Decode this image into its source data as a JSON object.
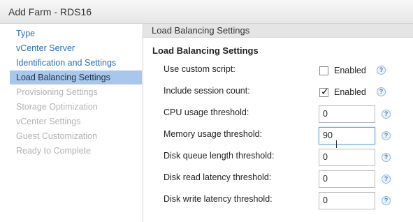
{
  "window": {
    "title": "Add Farm - RDS16"
  },
  "sidebar": {
    "items": [
      {
        "label": "Type",
        "state": "link"
      },
      {
        "label": "vCenter Server",
        "state": "link"
      },
      {
        "label": "Identification and Settings",
        "state": "link"
      },
      {
        "label": "Load Balancing Settings",
        "state": "active"
      },
      {
        "label": "Provisioning Settings",
        "state": "disabled"
      },
      {
        "label": "Storage Optimization",
        "state": "disabled"
      },
      {
        "label": "vCenter Settings",
        "state": "disabled"
      },
      {
        "label": "Guest Customization",
        "state": "disabled"
      },
      {
        "label": "Ready to Complete",
        "state": "disabled"
      }
    ]
  },
  "main": {
    "header": "Load Balancing Settings",
    "section_title": "Load Balancing Settings",
    "rows": [
      {
        "label": "Use custom script:",
        "type": "checkbox",
        "checked": false,
        "option_label": "Enabled",
        "help": "?"
      },
      {
        "label": "Include session count:",
        "type": "checkbox",
        "checked": true,
        "option_label": "Enabled",
        "help": "?"
      },
      {
        "label": "CPU usage threshold:",
        "type": "input",
        "value": "0",
        "help": "?"
      },
      {
        "label": "Memory usage threshold:",
        "type": "input",
        "value": "90",
        "focused": true,
        "help": "?"
      },
      {
        "label": "Disk queue length threshold:",
        "type": "input",
        "value": "0",
        "help": "?"
      },
      {
        "label": "Disk read latency threshold:",
        "type": "input",
        "value": "0",
        "help": "?"
      },
      {
        "label": "Disk write latency threshold:",
        "type": "input",
        "value": "0",
        "help": "?"
      }
    ]
  },
  "icons": {
    "check": "check-mark-icon",
    "help": "help-question-icon"
  }
}
